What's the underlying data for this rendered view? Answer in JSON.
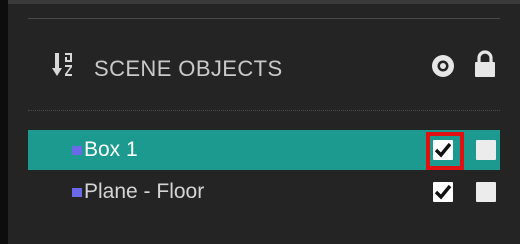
{
  "panel": {
    "title": "SCENE OBJECTS",
    "icons": {
      "sort": "sort-alpha-down-icon",
      "visibility": "eye-icon",
      "lock": "lock-icon"
    }
  },
  "objects": [
    {
      "name": "Box 1",
      "selected": true,
      "visible": true,
      "locked": false,
      "marker_color": "#6a6ae8"
    },
    {
      "name": "Plane - Floor",
      "selected": false,
      "visible": true,
      "locked": false,
      "marker_color": "#6a6ae8"
    }
  ],
  "colors": {
    "background": "#242424",
    "selected_row": "#1c9a8f",
    "focus_ring": "#e01010",
    "marker": "#6a6ae8"
  }
}
